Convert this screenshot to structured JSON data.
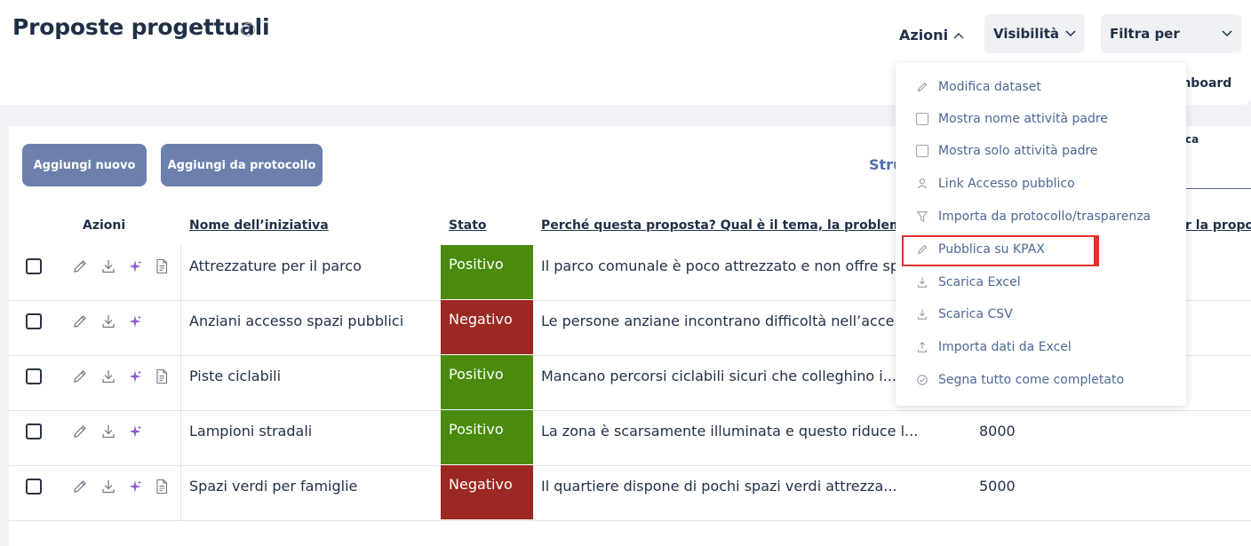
{
  "header": {
    "title": "Proposte progettuali",
    "help_glyph": "?",
    "azioni_label": "Azioni",
    "visibilita_label": "Visibilità",
    "filtra_label": "Filtra per",
    "dashboard_label": "shboard"
  },
  "toolbar": {
    "add_new": "Aggiungi nuovo",
    "add_from_protocol": "Aggiungi da protocollo",
    "stru_text": "Stru",
    "right_label": "ca"
  },
  "table": {
    "headers": {
      "azioni": "Azioni",
      "nome": "Nome dell’iniziativa",
      "stato": "Stato",
      "perche": "Perché questa proposta? Qual è il tema, la problem...",
      "right": "r la propos"
    },
    "rows": [
      {
        "name": "Attrezzature per il parco",
        "status": "Positivo",
        "description": "Il parco comunale è poco attrezzato e non offre sp...",
        "number": ""
      },
      {
        "name": "Anziani accesso spazi pubblici",
        "status": "Negativo",
        "description": "Le persone anziane incontrano difficoltà nell’acce...",
        "number": ""
      },
      {
        "name": "Piste ciclabili",
        "status": "Positivo",
        "description": "Mancano percorsi ciclabili sicuri che colleghino i...",
        "number": ""
      },
      {
        "name": "Lampioni stradali",
        "status": "Positivo",
        "description": "La zona è scarsamente illuminata e questo riduce l...",
        "number": "8000"
      },
      {
        "name": "Spazi verdi per famiglie",
        "status": "Negativo",
        "description": "Il quartiere dispone di pochi spazi verdi attrezza...",
        "number": "5000"
      }
    ]
  },
  "menu": {
    "items": [
      {
        "label": "Modifica dataset",
        "icon": "pencil-icon"
      },
      {
        "label": "Mostra nome attività padre",
        "icon": "checkbox"
      },
      {
        "label": "Mostra solo attività padre",
        "icon": "checkbox"
      },
      {
        "label": "Link Accesso pubblico",
        "icon": "person-icon"
      },
      {
        "label": "Importa da protocollo/trasparenza",
        "icon": "filter-icon"
      },
      {
        "label": "Pubblica su KPAX",
        "icon": "pencil-icon"
      },
      {
        "label": "Scarica Excel",
        "icon": "download-icon"
      },
      {
        "label": "Scarica CSV",
        "icon": "download-icon"
      },
      {
        "label": "Importa dati da Excel",
        "icon": "upload-icon"
      },
      {
        "label": "Segna tutto come completato",
        "icon": "check-circle-icon"
      }
    ]
  },
  "colors": {
    "positive": "#4a8a0d",
    "negative": "#9b2822",
    "button": "#6b80ab",
    "highlight": "#e5302a"
  }
}
